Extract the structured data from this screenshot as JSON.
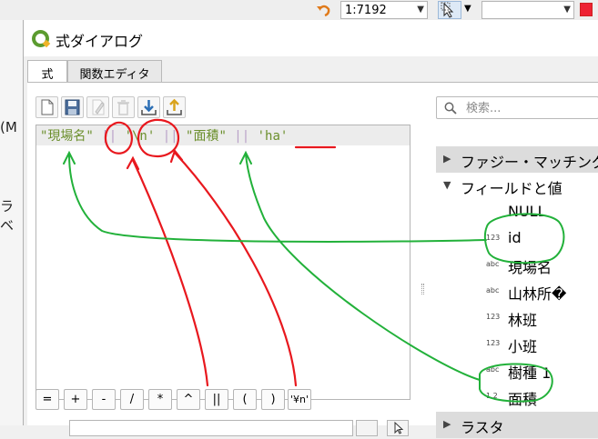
{
  "background_toolbar": {
    "scale_value": "1:7192"
  },
  "left_edge": {
    "fragments": [
      "(M",
      "ラベ"
    ]
  },
  "dialog": {
    "title": "式ダイアログ",
    "tabs": [
      {
        "label": "式",
        "active": true
      },
      {
        "label": "関数エディタ",
        "active": false
      }
    ],
    "toolbar_icons": [
      "new-file-icon",
      "save-icon",
      "edit-icon",
      "delete-icon",
      "import-icon",
      "export-icon"
    ],
    "expression": {
      "parts": [
        "\"現場名\"",
        " || ",
        "'\\n'",
        " || ",
        "\"面積\"",
        " || ",
        "'ha'"
      ]
    },
    "operators": [
      "=",
      "+",
      "-",
      "/",
      "*",
      "^",
      "||",
      "(",
      ")",
      "'¥n'"
    ],
    "search": {
      "placeholder": "検索..."
    },
    "tree": {
      "groups": [
        {
          "label": "ファジー・マッチング",
          "expanded": false
        },
        {
          "label": "フィールドと値",
          "expanded": true
        }
      ],
      "fields": [
        {
          "label": "NULL",
          "type": ""
        },
        {
          "label": "id",
          "type": "123"
        },
        {
          "label": "現場名",
          "type": "abc"
        },
        {
          "label": "山林所�",
          "type": "abc"
        },
        {
          "label": "林班",
          "type": "123"
        },
        {
          "label": "小班",
          "type": "123"
        },
        {
          "label": "樹種 1",
          "type": "abc"
        },
        {
          "label": "面積",
          "type": "1.2"
        }
      ],
      "after_groups": [
        {
          "label": "ラスタ",
          "expanded": false
        }
      ]
    }
  },
  "colors": {
    "string_literal": "#6b8f2c",
    "operator": "#b8a1c8",
    "annotation_red": "#e8181e",
    "annotation_green": "#22b13a",
    "qgis_green": "#5b9b2f"
  }
}
